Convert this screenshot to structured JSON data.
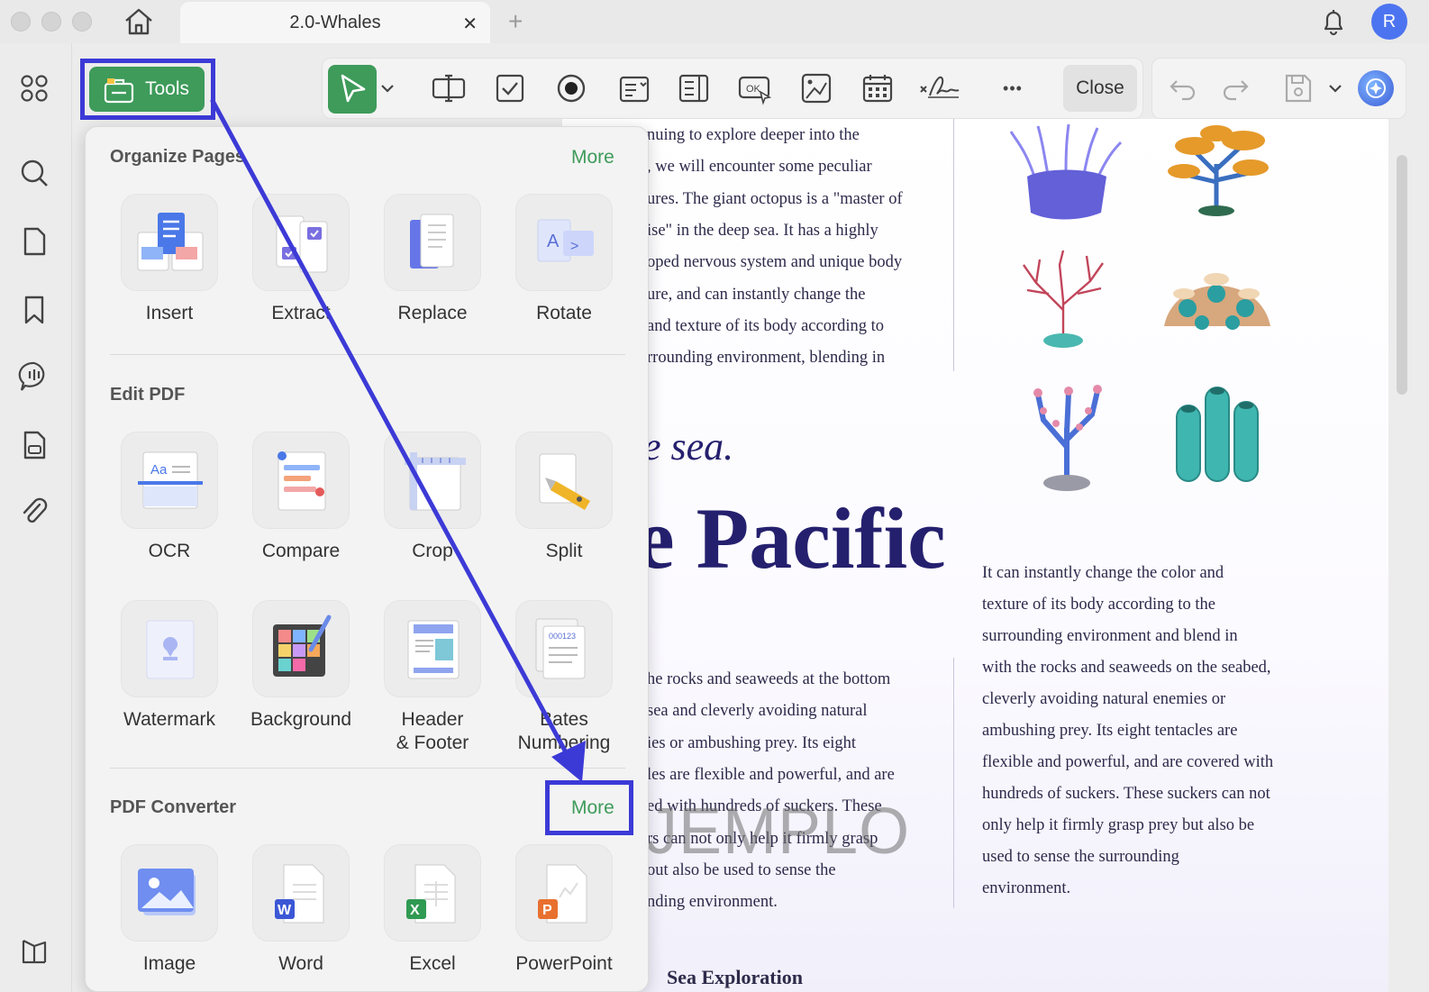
{
  "window": {
    "tab_title": "2.0-Whales",
    "tab_close": "✕",
    "tab_add": "+",
    "avatar_initial": "R"
  },
  "toolbar": {
    "tools_label": "Tools",
    "close_label": "Close",
    "more_dots": "•••"
  },
  "panel": {
    "sections": [
      {
        "title": "Organize Pages",
        "more": "More",
        "tools": [
          "Insert",
          "Extract",
          "Replace",
          "Rotate"
        ]
      },
      {
        "title": "Edit PDF",
        "tools": [
          "OCR",
          "Compare",
          "Crop",
          "Split",
          "Watermark",
          "Background",
          "Header\n& Footer",
          "Bates\nNumbering"
        ]
      },
      {
        "title": "PDF Converter",
        "more": "More",
        "tools": [
          "Image",
          "Word",
          "Excel",
          "PowerPoint"
        ]
      }
    ]
  },
  "document": {
    "col1_top": [
      "nuing to explore deeper into the",
      ", we will encounter some peculiar",
      "ures. The giant octopus is a \"master of",
      "ise\" in the deep sea. It has a highly",
      "oped nervous system and unique body",
      "ure, and can instantly change the",
      "and texture of its body according to",
      "rrounding environment, blending in"
    ],
    "heading_sea": "e sea.",
    "heading_pacific": "e Pacific",
    "col1_bottom": [
      "he rocks and seaweeds at the bottom",
      "sea and cleverly avoiding natural",
      "ies or ambushing prey. Its eight",
      "les are flexible and powerful, and are",
      "ed with hundreds of suckers. These",
      "rs can not only help it firmly grasp",
      "out also be used to sense the",
      "nding environment."
    ],
    "col2": [
      "It can instantly change the color and",
      "texture of its body according to the",
      "surrounding environment and blend in",
      "with the rocks and seaweeds on the seabed,",
      "cleverly avoiding natural enemies or",
      "ambushing prey. Its eight tentacles are",
      "flexible and powerful, and are covered with",
      "hundreds of suckers. These suckers can not",
      "only help it firmly grasp prey but also be",
      "used to sense the surrounding",
      "environment."
    ],
    "watermark": "JEMPLO",
    "footer_fragment": "Sea Exploration"
  },
  "colors": {
    "accent_green": "#3e9b5a",
    "highlight_blue": "#3c3ad6",
    "heading_navy": "#25206e"
  }
}
